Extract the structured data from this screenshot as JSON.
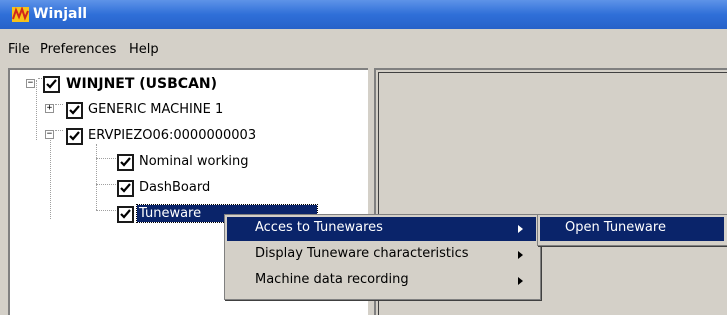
{
  "window": {
    "title": "Winjall",
    "icon": "winjall-app-icon"
  },
  "menubar": {
    "items": [
      "File",
      "Preferences",
      "Help"
    ]
  },
  "tree": {
    "root": {
      "label": "WINJNET (USBCAN)",
      "checked": true,
      "expander": "−"
    },
    "machines": [
      {
        "label": "GENERIC MACHINE 1",
        "checked": true,
        "expander": "+"
      },
      {
        "label": "ERVPIEZO06:0000000003",
        "checked": true,
        "expander": "−"
      }
    ],
    "children": [
      {
        "label": "Nominal working",
        "checked": true
      },
      {
        "label": "DashBoard",
        "checked": true
      },
      {
        "label": "Tuneware",
        "checked": true,
        "selected": true
      }
    ]
  },
  "context_menu": {
    "items": [
      {
        "label": "Acces to Tunewares",
        "has_submenu": true,
        "highlighted": true
      },
      {
        "label": "Display Tuneware characteristics",
        "has_submenu": true
      },
      {
        "label": "Machine data recording",
        "has_submenu": true
      }
    ]
  },
  "submenu": {
    "items": [
      {
        "label": "Open Tuneware",
        "highlighted": true
      }
    ]
  },
  "colors": {
    "title_bar": "#2f6fd8",
    "highlight": "#0a246a",
    "face": "#d4d0c8"
  }
}
